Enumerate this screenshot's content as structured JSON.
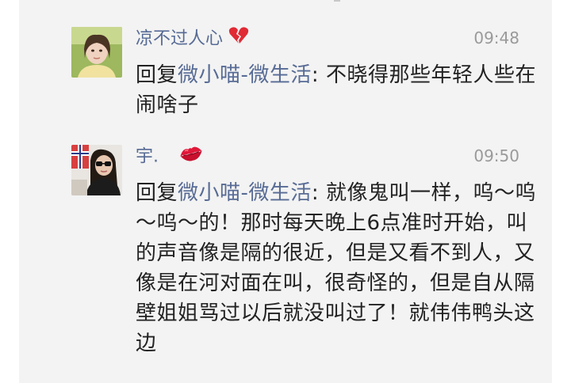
{
  "comments": [
    {
      "author": "凉不过人心",
      "author_emoji": "broken-heart-icon",
      "time": "09:48",
      "reply_prefix": "回复",
      "reply_to": "微小喵-微生活",
      "reply_sep": ": ",
      "text": "不晓得那些年轻人些在闹啥子"
    },
    {
      "author": "宇.",
      "author_emoji": "kiss-mark-icon",
      "time": "09:50",
      "reply_prefix": "回复",
      "reply_to": "微小喵-微生活",
      "reply_sep": ": ",
      "text": "就像鬼叫一样，呜～呜～呜～的！那时每天晚上6点准时开始，叫的声音像是隔的很近，但是又看不到人，又像是在河对面在叫，很奇怪的，但是自从隔壁姐姐骂过以后就没叫过了！就伟伟鸭头这边"
    }
  ],
  "colors": {
    "name": "#576b95",
    "time": "#9a9a9a",
    "text": "#222222",
    "panel": "#f3f3f3"
  }
}
